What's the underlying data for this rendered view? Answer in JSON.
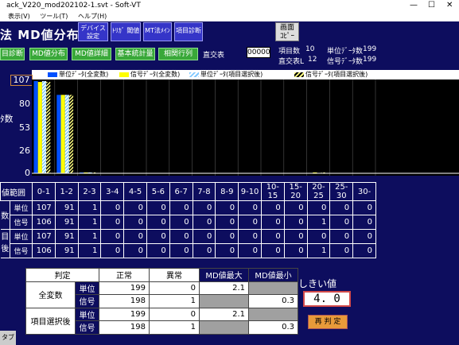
{
  "window": {
    "title": "ack_V220_mod202102-1.svt - Soft-VT"
  },
  "menu": [
    "表示(V)",
    "ツール(T)",
    "ヘルプ(H)"
  ],
  "header": {
    "title": "法  MD値分布",
    "buttons": [
      "デバイス\n設定",
      "ﾄﾘｶﾞ 閾値",
      "MT法ﾒｲﾝ",
      "項目診断"
    ],
    "copy_button": "画面\nｺﾋﾟｰ"
  },
  "nav": {
    "buttons": [
      "目診断",
      "MD値分布",
      "MD値詳細",
      "基本統計量",
      "相関行列"
    ],
    "orth_label": "直交表",
    "orth_value": "00000"
  },
  "info": {
    "item_count_label": "項目数",
    "item_count": "10",
    "orth_l_label": "直交表L",
    "orth_l": "12",
    "unit_count_label": "単位ﾃﾞｰﾀ数",
    "unit_count": "199",
    "signal_count_label": "信号ﾃﾞｰﾀ数",
    "signal_count": "199"
  },
  "colors": {
    "unit_all": "#0050ff",
    "signal_all": "#ffff00",
    "unit_sel": "#80c8ff",
    "signal_sel": "#ffff80"
  },
  "chart_data": {
    "type": "bar",
    "ylabel": "ﾀ数",
    "ymax_label": "107",
    "yticks": [
      0,
      26,
      53,
      80
    ],
    "ylim": [
      0,
      107
    ],
    "categories": [
      "0-1",
      "1-2",
      "2-3",
      "3-4",
      "4-5",
      "5-6",
      "6-7",
      "7-8",
      "8-9",
      "9-10",
      "10-15",
      "15-20",
      "20-25",
      "25-30",
      "30-"
    ],
    "series": [
      {
        "name": "単位ﾃﾞｰﾀ(全変数)",
        "values": [
          107,
          91,
          1,
          0,
          0,
          0,
          0,
          0,
          0,
          0,
          0,
          0,
          0,
          0,
          0
        ]
      },
      {
        "name": "信号ﾃﾞｰﾀ(全変数)",
        "values": [
          106,
          91,
          1,
          0,
          0,
          0,
          0,
          0,
          0,
          0,
          0,
          0,
          1,
          0,
          0
        ]
      },
      {
        "name": "単位ﾃﾞｰﾀ(項目選択後)",
        "values": [
          107,
          91,
          1,
          0,
          0,
          0,
          0,
          0,
          0,
          0,
          0,
          0,
          0,
          0,
          0
        ]
      },
      {
        "name": "信号ﾃﾞｰﾀ(項目選択後)",
        "values": [
          106,
          91,
          1,
          0,
          0,
          0,
          0,
          0,
          0,
          0,
          0,
          0,
          1,
          0,
          0
        ]
      }
    ]
  },
  "freq_table": {
    "range_label": "値範囲",
    "rows": [
      {
        "group": "数",
        "sub": "単位",
        "values": [
          "107",
          "91",
          "1",
          "0",
          "0",
          "0",
          "0",
          "0",
          "0",
          "0",
          "0",
          "0",
          "0",
          "0",
          "0"
        ]
      },
      {
        "group": "",
        "sub": "信号",
        "values": [
          "106",
          "91",
          "1",
          "0",
          "0",
          "0",
          "0",
          "0",
          "0",
          "0",
          "0",
          "0",
          "1",
          "0",
          "0"
        ]
      },
      {
        "group": "目",
        "sub": "単位",
        "values": [
          "107",
          "91",
          "1",
          "0",
          "0",
          "0",
          "0",
          "0",
          "0",
          "0",
          "0",
          "0",
          "0",
          "0",
          "0"
        ]
      },
      {
        "group": "後",
        "sub": "信号",
        "values": [
          "106",
          "91",
          "1",
          "0",
          "0",
          "0",
          "0",
          "0",
          "0",
          "0",
          "0",
          "0",
          "1",
          "0",
          "0"
        ]
      }
    ]
  },
  "judge_table": {
    "headers": [
      "判定",
      "正常",
      "異常",
      "MD値最大",
      "MD値最小"
    ],
    "groups": [
      {
        "label": "全変数",
        "rows": [
          {
            "sub": "単位",
            "normal": "199",
            "abnormal": "0",
            "max": "2.1",
            "min": ""
          },
          {
            "sub": "信号",
            "normal": "198",
            "abnormal": "1",
            "max": "",
            "min": "0.3"
          }
        ]
      },
      {
        "label": "項目選択後",
        "rows": [
          {
            "sub": "単位",
            "normal": "199",
            "abnormal": "0",
            "max": "2.1",
            "min": ""
          },
          {
            "sub": "信号",
            "normal": "198",
            "abnormal": "1",
            "max": "",
            "min": "0.3"
          }
        ]
      }
    ]
  },
  "threshold": {
    "label": "しきい値",
    "value": "4. 0",
    "rejudge_button": "再 判 定"
  },
  "tab_label": "タブ"
}
